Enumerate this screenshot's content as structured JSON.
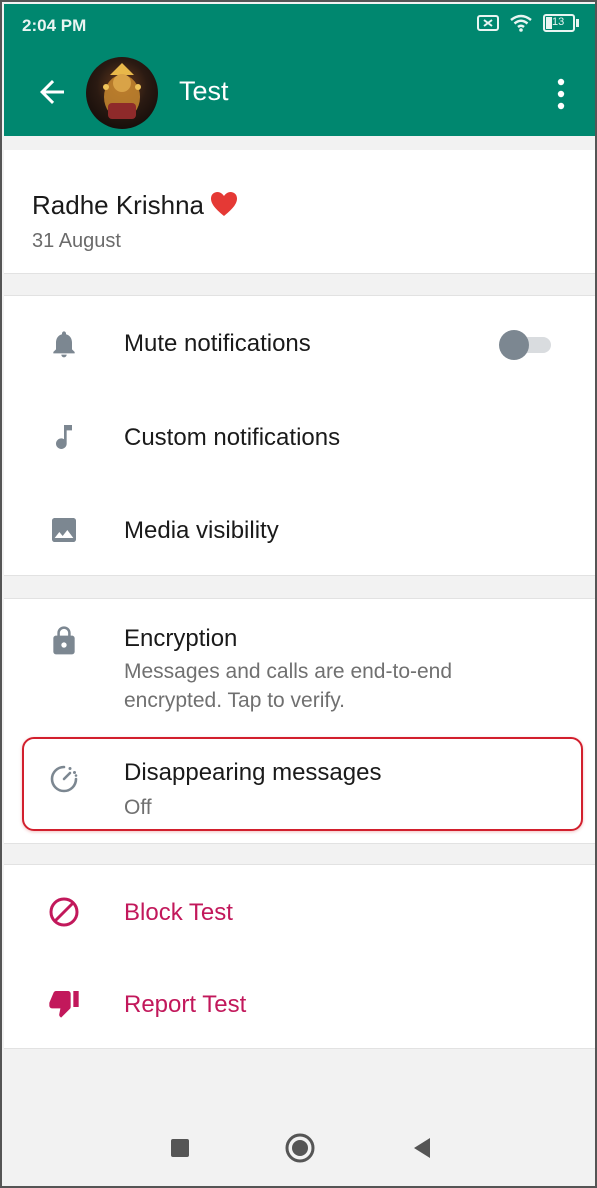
{
  "status_bar": {
    "time": "2:04 PM",
    "battery": "13"
  },
  "header": {
    "title": "Test"
  },
  "about": {
    "text": "Radhe Krishna",
    "date": "31 August"
  },
  "notifications": {
    "mute_label": "Mute notifications",
    "mute_on": false,
    "custom_label": "Custom notifications",
    "media_label": "Media visibility"
  },
  "encryption": {
    "label": "Encryption",
    "sub_line1": "Messages and calls are end-to-end",
    "sub_line2": "encrypted. Tap to verify."
  },
  "disappearing": {
    "label": "Disappearing messages",
    "value": "Off"
  },
  "actions": {
    "block_label": "Block Test",
    "report_label": "Report Test"
  },
  "colors": {
    "appbar": "#00876f",
    "danger": "#c2185b",
    "highlight": "#d21f2d"
  },
  "icons": [
    "back-arrow-icon",
    "more-vert-icon",
    "bell-icon",
    "music-note-icon",
    "image-icon",
    "lock-icon",
    "timer-icon",
    "block-icon",
    "thumb-down-icon",
    "wifi-icon",
    "battery-icon",
    "sim-icon"
  ]
}
